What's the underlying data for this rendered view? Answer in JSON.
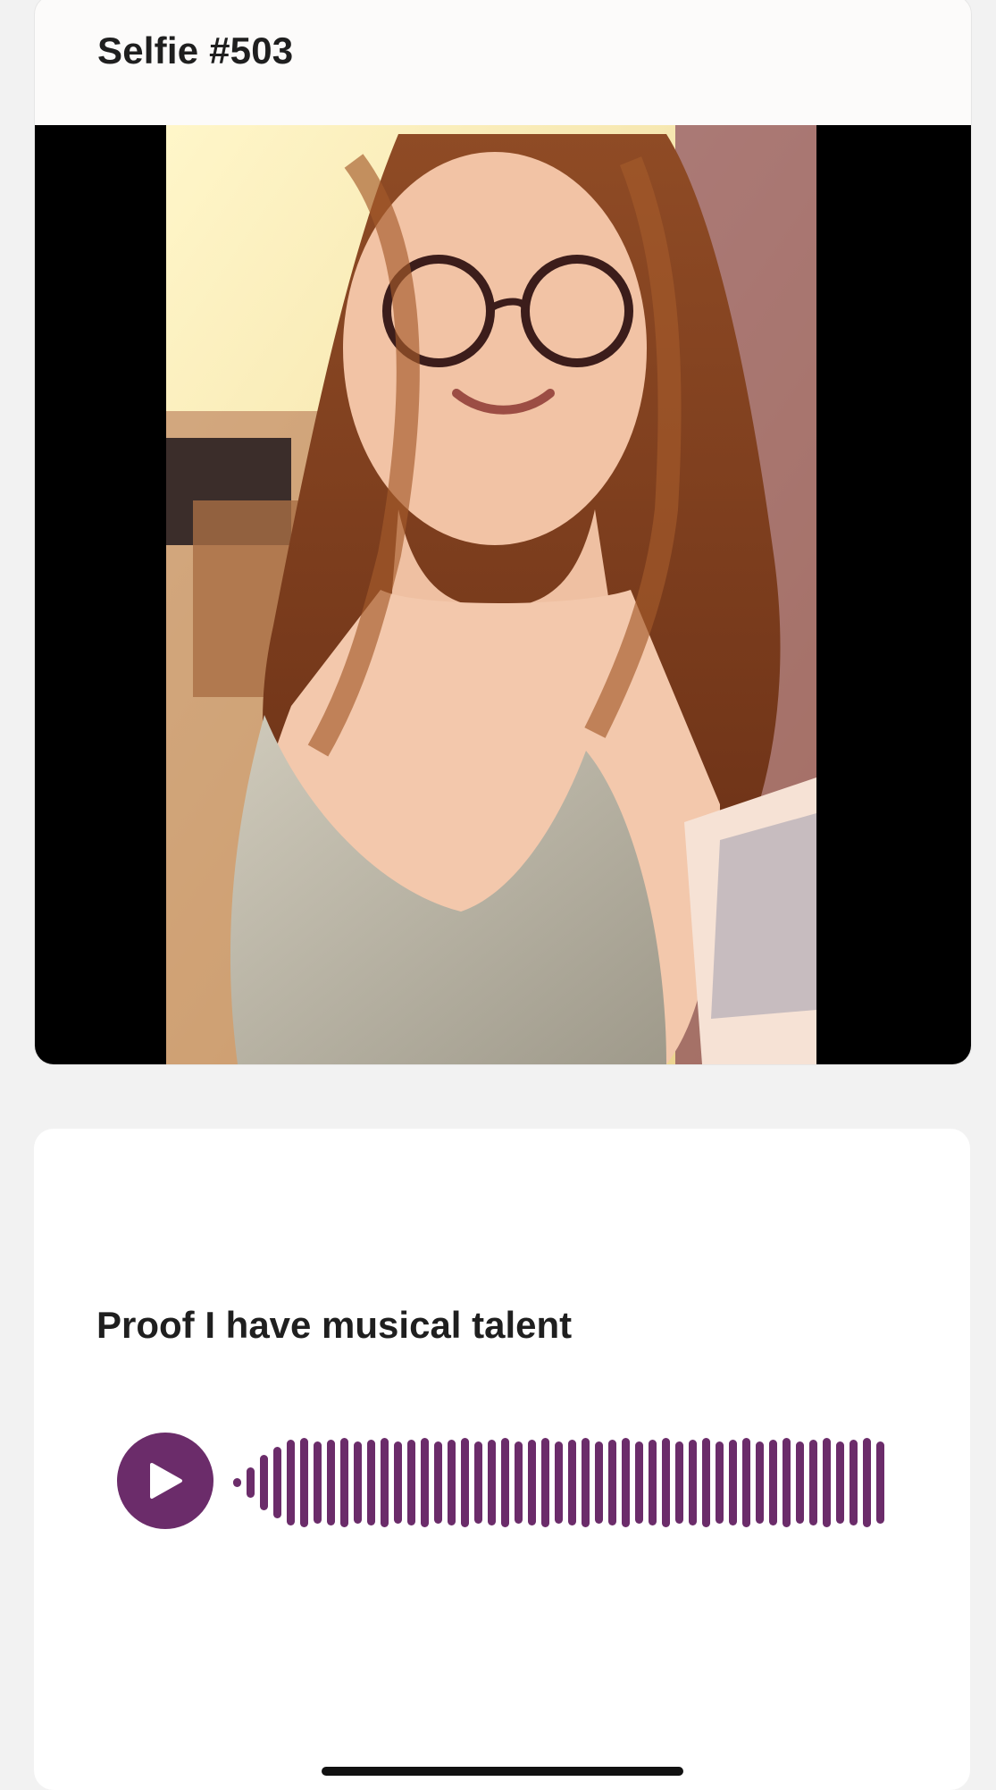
{
  "selfie": {
    "title": "Selfie #503",
    "photo_alt": "selfie photo"
  },
  "prompt": {
    "text": "Proof I have musical talent"
  },
  "audio": {
    "play_icon": "play-icon",
    "waveform_icon": "waveform-icon"
  },
  "colors": {
    "accent": "#6b2c6a",
    "text": "#1f1f1f",
    "page_bg": "#f2f2f2"
  }
}
